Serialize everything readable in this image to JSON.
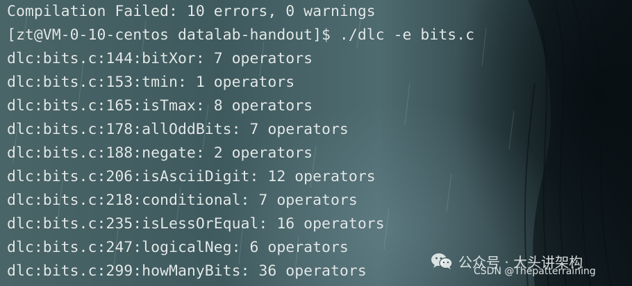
{
  "terminal": {
    "lines": [
      "Compilation Failed: 10 errors, 0 warnings",
      "[zt@VM-0-10-centos datalab-handout]$ ./dlc -e bits.c",
      "dlc:bits.c:144:bitXor: 7 operators",
      "dlc:bits.c:153:tmin: 1 operators",
      "dlc:bits.c:165:isTmax: 8 operators",
      "dlc:bits.c:178:allOddBits: 7 operators",
      "dlc:bits.c:188:negate: 2 operators",
      "dlc:bits.c:206:isAsciiDigit: 12 operators",
      "dlc:bits.c:218:conditional: 7 operators",
      "dlc:bits.c:235:isLessOrEqual: 16 operators",
      "dlc:bits.c:247:logicalNeg: 6 operators",
      "dlc:bits.c:299:howManyBits: 36 operators"
    ],
    "text_color": "#e3eaea"
  },
  "watermark": {
    "icon": "wechat-icon",
    "account": "公众号 · 大头讲架构",
    "source": "CSDN @Thepatterraining"
  }
}
